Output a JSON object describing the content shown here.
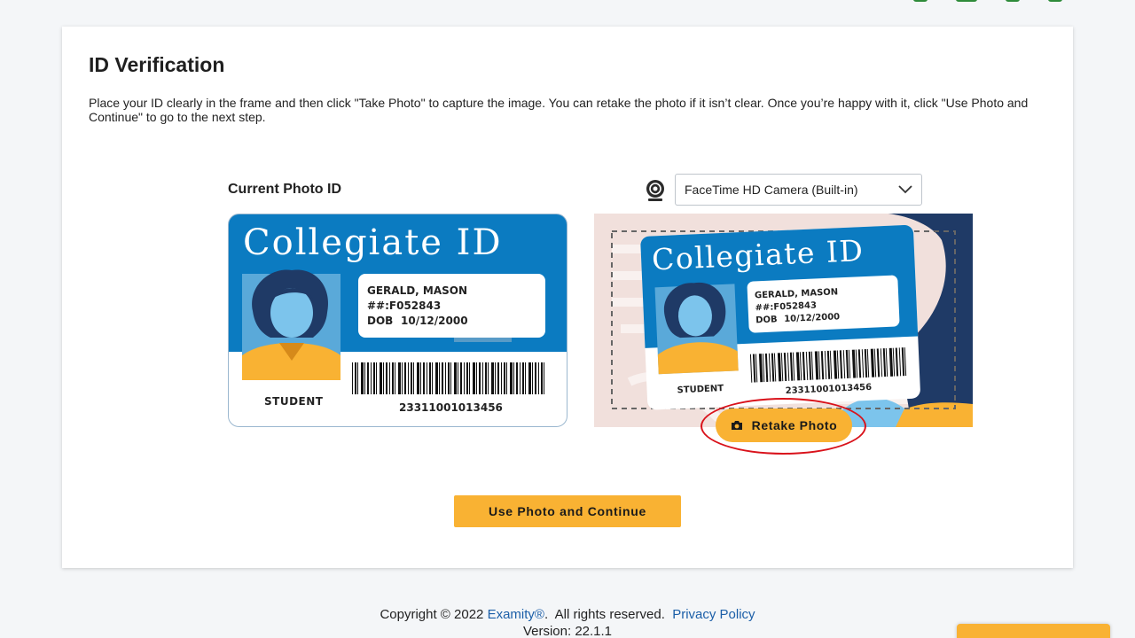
{
  "page": {
    "title": "ID Verification",
    "instructions": "Place your ID clearly in the frame and then click \"Take Photo\" to capture the image. You can retake the photo if it isn’t clear. Once you’re happy with it, click \"Use Photo and Continue\" to go to the next step."
  },
  "current_id": {
    "label": "Current Photo ID",
    "card_title": "Collegiate ID",
    "name": "GERALD, MASON",
    "id_number": "##:F052843",
    "dob_label": "DOB",
    "dob": "10/12/2000",
    "role": "STUDENT",
    "barcode": "23311001013456"
  },
  "camera": {
    "icon": "webcam-icon",
    "selected": "FaceTime HD Camera (Built-in)"
  },
  "preview": {
    "retake_label": "Retake Photo",
    "retake_icon": "camera-icon"
  },
  "actions": {
    "continue_label": "Use Photo and Continue"
  },
  "footer": {
    "copyright": "Copyright © 2022 ",
    "brand": "Examity®",
    "rights": ".  All rights reserved.  ",
    "privacy": "Privacy Policy",
    "version": "Version: 22.1.1"
  },
  "colors": {
    "accent": "#f9b233",
    "id_blue": "#0b7bc1",
    "link": "#1c5fa8",
    "highlight_ring": "#d9121b"
  }
}
